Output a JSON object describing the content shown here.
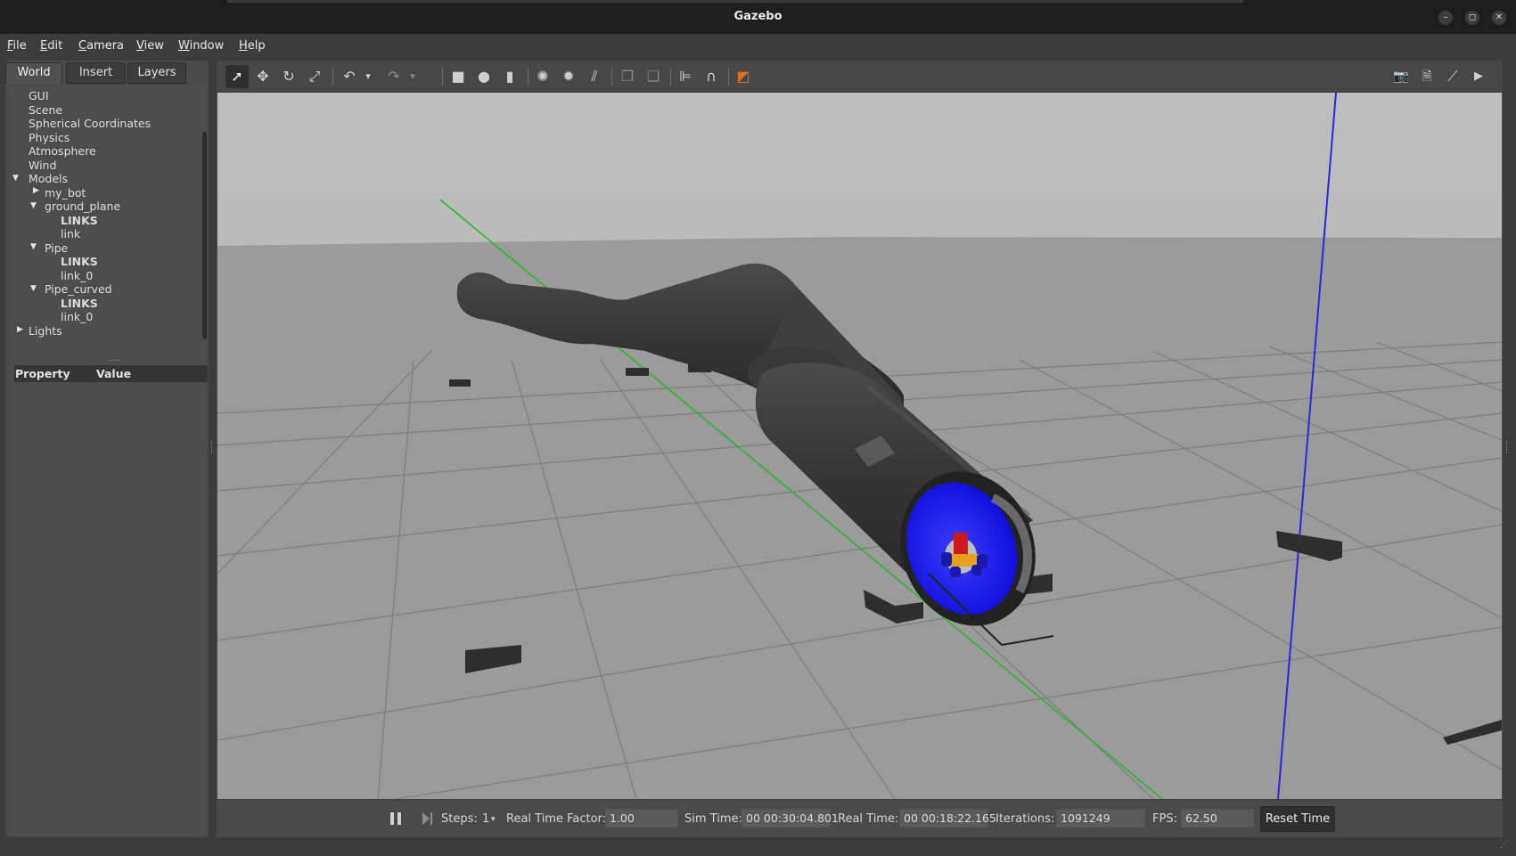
{
  "window": {
    "title": "Gazebo",
    "minimize_label": "–",
    "maximize_label": "◻",
    "close_label": "✕"
  },
  "menubar": {
    "items": [
      {
        "mnemonic": "F",
        "rest": "ile"
      },
      {
        "mnemonic": "E",
        "rest": "dit"
      },
      {
        "mnemonic": "C",
        "rest": "amera"
      },
      {
        "mnemonic": "V",
        "rest": "iew"
      },
      {
        "mnemonic": "W",
        "rest": "indow"
      },
      {
        "mnemonic": "H",
        "rest": "elp"
      }
    ]
  },
  "left_panel": {
    "tabs": [
      "World",
      "Insert",
      "Layers"
    ],
    "active_tab": "World",
    "tree": [
      {
        "label": "GUI"
      },
      {
        "label": "Scene"
      },
      {
        "label": "Spherical Coordinates"
      },
      {
        "label": "Physics"
      },
      {
        "label": "Atmosphere"
      },
      {
        "label": "Wind"
      },
      {
        "label": "Models",
        "expander": "expanded"
      },
      {
        "label": "my_bot",
        "expander": "collapsed"
      },
      {
        "label": "ground_plane",
        "expander": "expanded"
      },
      {
        "label": "LINKS",
        "bold": true
      },
      {
        "label": "link"
      },
      {
        "label": "Pipe",
        "expander": "expanded"
      },
      {
        "label": "LINKS",
        "bold": true
      },
      {
        "label": "link_0"
      },
      {
        "label": "Pipe_curved",
        "expander": "expanded"
      },
      {
        "label": "LINKS",
        "bold": true
      },
      {
        "label": "link_0"
      },
      {
        "label": "Lights",
        "expander": "collapsed"
      }
    ],
    "property_header": {
      "property": "Property",
      "value": "Value"
    }
  },
  "toolbar": {
    "icons": [
      {
        "name": "select-mode-icon",
        "glyph": "➚",
        "active": true
      },
      {
        "name": "translate-mode-icon",
        "glyph": "✥"
      },
      {
        "name": "rotate-mode-icon",
        "glyph": "↻"
      },
      {
        "name": "scale-mode-icon",
        "glyph": "⤢"
      },
      {
        "name": "undo-icon",
        "glyph": "↶"
      },
      {
        "name": "undo-history-dropdown-icon",
        "glyph": "▾"
      },
      {
        "name": "redo-icon",
        "glyph": "↷"
      },
      {
        "name": "redo-history-dropdown-icon",
        "glyph": "▾"
      },
      {
        "name": "box-shape-icon",
        "glyph": "■"
      },
      {
        "name": "sphere-shape-icon",
        "glyph": "●"
      },
      {
        "name": "cylinder-shape-icon",
        "glyph": "▮"
      },
      {
        "name": "point-light-icon",
        "glyph": "✺"
      },
      {
        "name": "spot-light-icon",
        "glyph": "✹"
      },
      {
        "name": "directional-light-icon",
        "glyph": "⫽"
      },
      {
        "name": "copy-icon",
        "glyph": "❐"
      },
      {
        "name": "paste-icon",
        "glyph": "❏"
      },
      {
        "name": "align-icon",
        "glyph": "⊫"
      },
      {
        "name": "snap-icon",
        "glyph": "∩"
      },
      {
        "name": "view-angle-icon",
        "glyph": "◩"
      },
      {
        "name": "screenshot-icon",
        "glyph": "📷"
      },
      {
        "name": "log-icon",
        "glyph": "🗎"
      },
      {
        "name": "plot-icon",
        "glyph": "⟋"
      },
      {
        "name": "video-record-icon",
        "glyph": "▶"
      }
    ],
    "accent_color": "#e8711c"
  },
  "bottom_bar": {
    "steps_label": "Steps:",
    "steps_value": "1",
    "rtf_label": "Real Time Factor:",
    "rtf_value": "1.00",
    "sim_time_label": "Sim Time:",
    "sim_time_value": "00 00:30:04.801",
    "real_time_label": "Real Time:",
    "real_time_value": "00 00:18:22.165",
    "iterations_label": "Iterations:",
    "iterations_value": "1091249",
    "fps_label": "FPS:",
    "fps_value": "62.50",
    "reset_label": "Reset Time"
  },
  "scene_colors": {
    "sky": "#bcbcbc",
    "ground": "#9a9a9a",
    "pipe": "#3a3a3a",
    "pipe_interior": "#1a1aff",
    "x_axis": "#22cc22",
    "z_axis": "#2222dd"
  }
}
